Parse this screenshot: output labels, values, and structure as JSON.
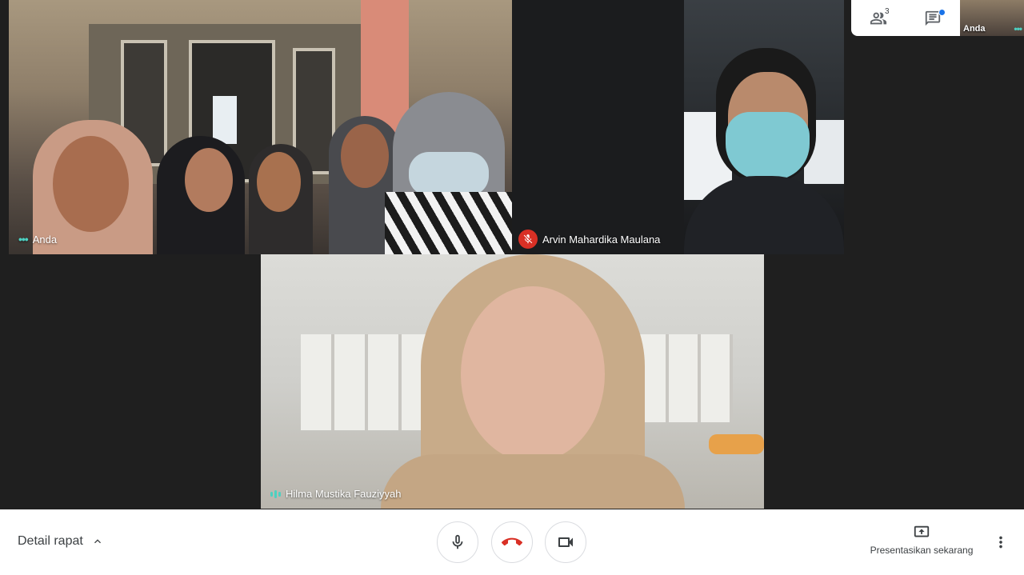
{
  "participants": {
    "you": {
      "name": "Anda"
    },
    "arvin": {
      "name": "Arvin Mahardika Maulana",
      "muted": true
    },
    "hilma": {
      "name": "Hilma Mustika Fauziyyah"
    }
  },
  "topbar": {
    "people_count": "3",
    "self_thumb_label": "Anda"
  },
  "bottombar": {
    "meeting_details_label": "Detail rapat",
    "present_label": "Presentasikan sekarang"
  },
  "colors": {
    "end_call": "#d93025",
    "accent_teal": "#4dd0c1",
    "chat_indicator": "#1a73e8",
    "mute_badge": "#d93025"
  },
  "icons": [
    "people-icon",
    "chat-icon",
    "microphone-icon",
    "hang-up-icon",
    "camera-icon",
    "present-screen-icon",
    "more-vert-icon",
    "chevron-up-icon",
    "mic-off-icon"
  ]
}
